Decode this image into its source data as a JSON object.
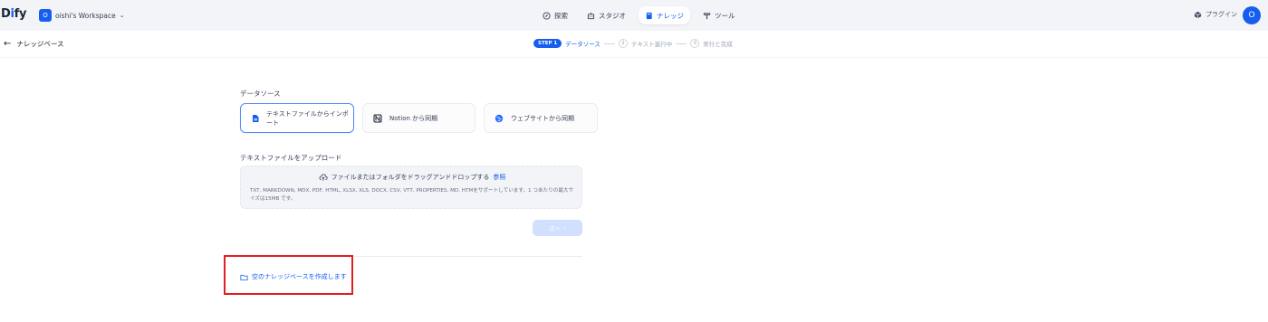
{
  "app": {
    "logo": {
      "main": "D",
      "accent": "i",
      "rest": "fy"
    },
    "workspace": {
      "avatar_letter": "O",
      "name": "oishi's Workspace"
    }
  },
  "nav": {
    "items": [
      {
        "label": "探索",
        "icon": "compass-icon",
        "active": false
      },
      {
        "label": "スタジオ",
        "icon": "robot-icon",
        "active": false
      },
      {
        "label": "ナレッジ",
        "icon": "book-icon",
        "active": true
      },
      {
        "label": "ツール",
        "icon": "hammer-icon",
        "active": false
      }
    ]
  },
  "header_right": {
    "plugin_label": "プラグイン",
    "user_initial": "O"
  },
  "subbar": {
    "back_label": "ナレッジベース",
    "steps": {
      "step1_badge": "STEP 1",
      "step1_label": "データソース",
      "step2_num": "2",
      "step2_label": "テキスト進行中",
      "step3_num": "3",
      "step3_label": "実行と完成"
    }
  },
  "main": {
    "datasource_title": "データソース",
    "datasource_options": [
      {
        "label": "テキストファイルからインポート",
        "icon": "file-icon",
        "selected": true
      },
      {
        "label": "Notion から同期",
        "icon": "notion-icon",
        "selected": false
      },
      {
        "label": "ウェブサイトから同期",
        "icon": "globe-icon",
        "selected": false
      }
    ],
    "upload": {
      "title": "テキストファイルをアップロード",
      "drop_text": "ファイルまたはフォルダをドラッグアンドドロップする",
      "browse_label": "参照",
      "support_text": "TXT, MARKDOWN, MDX, PDF, HTML, XLSX, XLS, DOCX, CSV, VTT, PROPERTIES, MD, HTMをサポートしています。1 つあたりの最大サイズは15MB です。"
    },
    "next_button": "次へ",
    "create_empty_label": "空のナレッジベースを作成します"
  },
  "colors": {
    "accent": "#155eef",
    "highlight": "#e02020",
    "header_bg": "#f2f4f7"
  }
}
